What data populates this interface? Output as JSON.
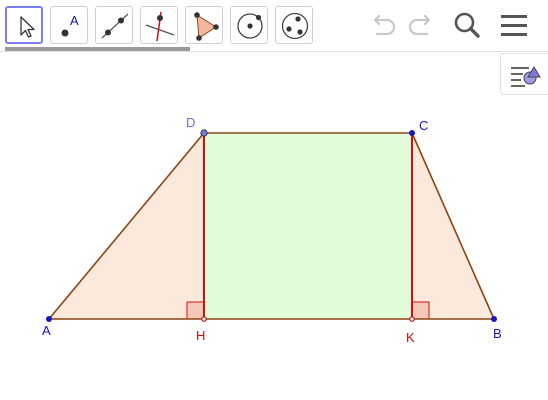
{
  "toolbar": {
    "tools": [
      {
        "name": "move-tool",
        "selected": true
      },
      {
        "name": "point-tool",
        "label": "A"
      },
      {
        "name": "line-tool"
      },
      {
        "name": "perpendicular-line-tool"
      },
      {
        "name": "polygon-tool"
      },
      {
        "name": "circle-tool"
      },
      {
        "name": "ellipse-tool"
      }
    ],
    "controls": [
      "undo-icon",
      "redo-icon",
      "search-icon",
      "menu-icon"
    ]
  },
  "style_bar": {
    "icon": "style-bar-toggle-icon"
  },
  "construction": {
    "points": {
      "A": {
        "label": "A"
      },
      "B": {
        "label": "B"
      },
      "C": {
        "label": "C"
      },
      "D": {
        "label": "D"
      },
      "H": {
        "label": "H"
      },
      "K": {
        "label": "K"
      }
    },
    "colors": {
      "trapezoid_edge": "#8b4513",
      "triangle_fill": "#fde8dc",
      "rectangle_fill": "#e2fbd9",
      "altitude": "#d11010",
      "point_blue": "#1515c8",
      "point_red": "#d11010",
      "label_D": "#6f6fd8"
    }
  }
}
